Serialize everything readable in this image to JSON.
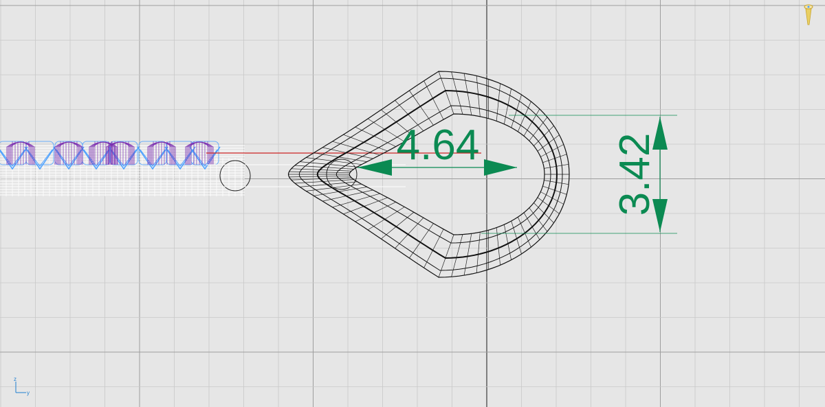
{
  "viewport": {
    "name": "front-viewport",
    "background": "#e6e6e6",
    "grid_minor_color": "#c9c9c9",
    "grid_major_color": "#9d9d9d",
    "axis_color": "#3a3a3a"
  },
  "dimensions": {
    "horizontal": {
      "label": "4.64",
      "color": "#0b8a52"
    },
    "vertical": {
      "label": "3.42",
      "color": "#0b8a52"
    }
  },
  "axis_indicator": {
    "z_label": "z",
    "y_label": "y",
    "color": "#1f7fd0"
  },
  "icons": {
    "top_right": "pin-icon"
  },
  "colors": {
    "wire_purple": "#7a2fb0",
    "wire_blue": "#4aa0ff",
    "wire_white": "#ffffff",
    "wire_black": "#111111",
    "red_line": "#cc2222",
    "dim_green": "#0b8a52"
  }
}
